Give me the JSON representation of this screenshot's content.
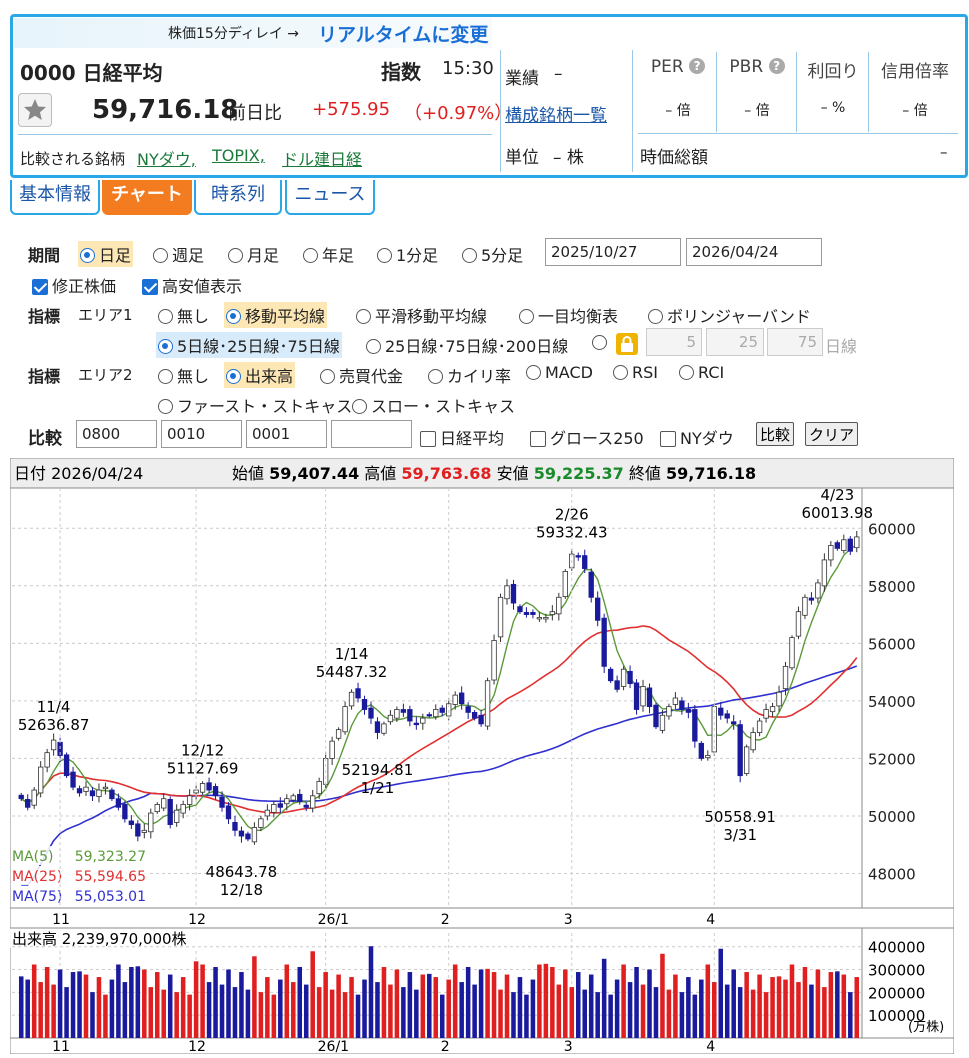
{
  "header": {
    "rt_prefix": "株価15分ディレイ →",
    "rt_link": "リアルタイムに変更",
    "code_name": "0000 日経平均",
    "type": "指数",
    "time": "15:30",
    "price": "59,716.18",
    "prev_label": "前日比",
    "change": "+575.95",
    "change_pct": "（+0.97%）",
    "compare_label": "比較される銘柄",
    "compare_links": [
      "NYダウ,",
      "TOPIX,",
      "ドル建日経"
    ],
    "perf_label": "業績",
    "perf_value": "–",
    "constituents_link": "構成銘柄一覧",
    "unit_label": "単位",
    "unit_value": "– 株",
    "metrics": [
      {
        "label": "PER",
        "value": "– 倍",
        "help": "?"
      },
      {
        "label": "PBR",
        "value": "– 倍",
        "help": "?"
      },
      {
        "label": "利回り",
        "value": "– %"
      },
      {
        "label": "信用倍率",
        "value": "– 倍"
      }
    ],
    "marketcap_label": "時価総額",
    "marketcap_value": "–"
  },
  "tabs": [
    "基本情報",
    "チャート",
    "時系列",
    "ニュース"
  ],
  "form": {
    "period_label": "期間",
    "period_options": [
      "日足",
      "週足",
      "月足",
      "年足",
      "1分足",
      "5分足"
    ],
    "date_from": "2025/10/27",
    "date_to": "2026/04/24",
    "adjusted": "修正株価",
    "highlow": "高安値表示",
    "ind_label": "指標",
    "area1": "エリア1",
    "area1_options": [
      "無し",
      "移動平均線",
      "平滑移動平均線",
      "一目均衡表",
      "ボリンジャーバンド"
    ],
    "ma_option1": "5日線･25日線･75日線",
    "ma_option2": "25日線･75日線･200日線",
    "ma_custom": [
      "5",
      "25",
      "75"
    ],
    "ma_custom_unit": "日線",
    "area2": "エリア2",
    "area2_options": [
      "無し",
      "出来高",
      "売買代金",
      "カイリ率",
      "MACD",
      "RSI",
      "RCI"
    ],
    "area2_options2": [
      "ファースト・ストキャス",
      "スロー・ストキャス"
    ],
    "compare_label": "比較",
    "compare_codes": [
      "0800",
      "0010",
      "0001",
      ""
    ],
    "compare_checks": [
      "日経平均",
      "グロース250",
      "NYダウ"
    ],
    "compare_btn": "比較",
    "clear_btn": "クリア"
  },
  "chart_data": {
    "type": "candlestick",
    "info": {
      "date_label": "日付",
      "date": "2026/04/24",
      "open_label": "始値",
      "open": "59,407.44",
      "high_label": "高値",
      "high": "59,763.68",
      "low_label": "安値",
      "low": "59,225.37",
      "close_label": "終値",
      "close": "59,716.18"
    },
    "y_ticks": [
      "60000",
      "58000",
      "56000",
      "54000",
      "52000",
      "50000",
      "48000"
    ],
    "x_ticks": [
      "11",
      "12",
      "26/1",
      "2",
      "3",
      "4"
    ],
    "closes": [
      50600,
      50300,
      50900,
      51700,
      52200,
      52637,
      52100,
      51400,
      51000,
      50800,
      51000,
      50700,
      50900,
      51000,
      50600,
      50300,
      49900,
      49700,
      49300,
      49500,
      50100,
      50400,
      50600,
      49700,
      50200,
      50400,
      50700,
      50900,
      51128,
      50900,
      50700,
      50300,
      49900,
      49500,
      49300,
      49200,
      49600,
      49900,
      50200,
      50400,
      50300,
      50600,
      50700,
      50500,
      50300,
      50700,
      51200,
      52000,
      52600,
      53000,
      53800,
      54300,
      54100,
      53700,
      53400,
      52900,
      53200,
      53500,
      53700,
      53600,
      53300,
      53200,
      53400,
      53500,
      53700,
      53600,
      53900,
      54200,
      53900,
      53600,
      53400,
      53200,
      54700,
      56100,
      57600,
      58000,
      57400,
      57100,
      57000,
      57000,
      56900,
      56900,
      57100,
      57600,
      58500,
      59100,
      59000,
      58600,
      57600,
      56800,
      55200,
      54700,
      54400,
      55100,
      54600,
      53700,
      54500,
      53800,
      53100,
      53500,
      53800,
      54100,
      53700,
      53600,
      52600,
      52000,
      52100,
      53800,
      53500,
      53400,
      53200,
      51400,
      52400,
      52900,
      53300,
      53700,
      53800,
      54300,
      55200,
      56200,
      57100,
      57600,
      57500,
      58100,
      58900,
      59400,
      59300,
      59600,
      59200,
      59700
    ],
    "annotations": [
      {
        "label": "11/4",
        "value": "52636.87"
      },
      {
        "label": "12/12",
        "value": "51127.69"
      },
      {
        "label": "12/18",
        "value": "48643.78"
      },
      {
        "label": "1/14",
        "value": "54487.32"
      },
      {
        "label": "1/21",
        "value": "52194.81"
      },
      {
        "label": "2/26",
        "value": "59332.43"
      },
      {
        "label": "3/31",
        "value": "50558.91"
      },
      {
        "label": "4/23",
        "value": "60013.98"
      }
    ],
    "ma_legend": [
      {
        "name": "MA(5)",
        "value": "59,323.27",
        "color": "#5a9a3a"
      },
      {
        "name": "MA(25)",
        "value": "55,594.65",
        "color": "#e03030"
      },
      {
        "name": "MA(75)",
        "value": "55,053.01",
        "color": "#3030d0"
      }
    ],
    "colors": {
      "up": "#ffffff",
      "down": "#1a1a9c",
      "ma5": "#5a9a3a",
      "ma25": "#e03030",
      "ma75": "#3030d0"
    },
    "volume": {
      "label": "出来高",
      "total": "2,239,970,000株",
      "y_ticks": [
        "400000",
        "300000",
        "200000",
        "100000"
      ],
      "unit": "(万株)",
      "up_color": "#e02020",
      "down_color": "#1a1a9c"
    }
  }
}
